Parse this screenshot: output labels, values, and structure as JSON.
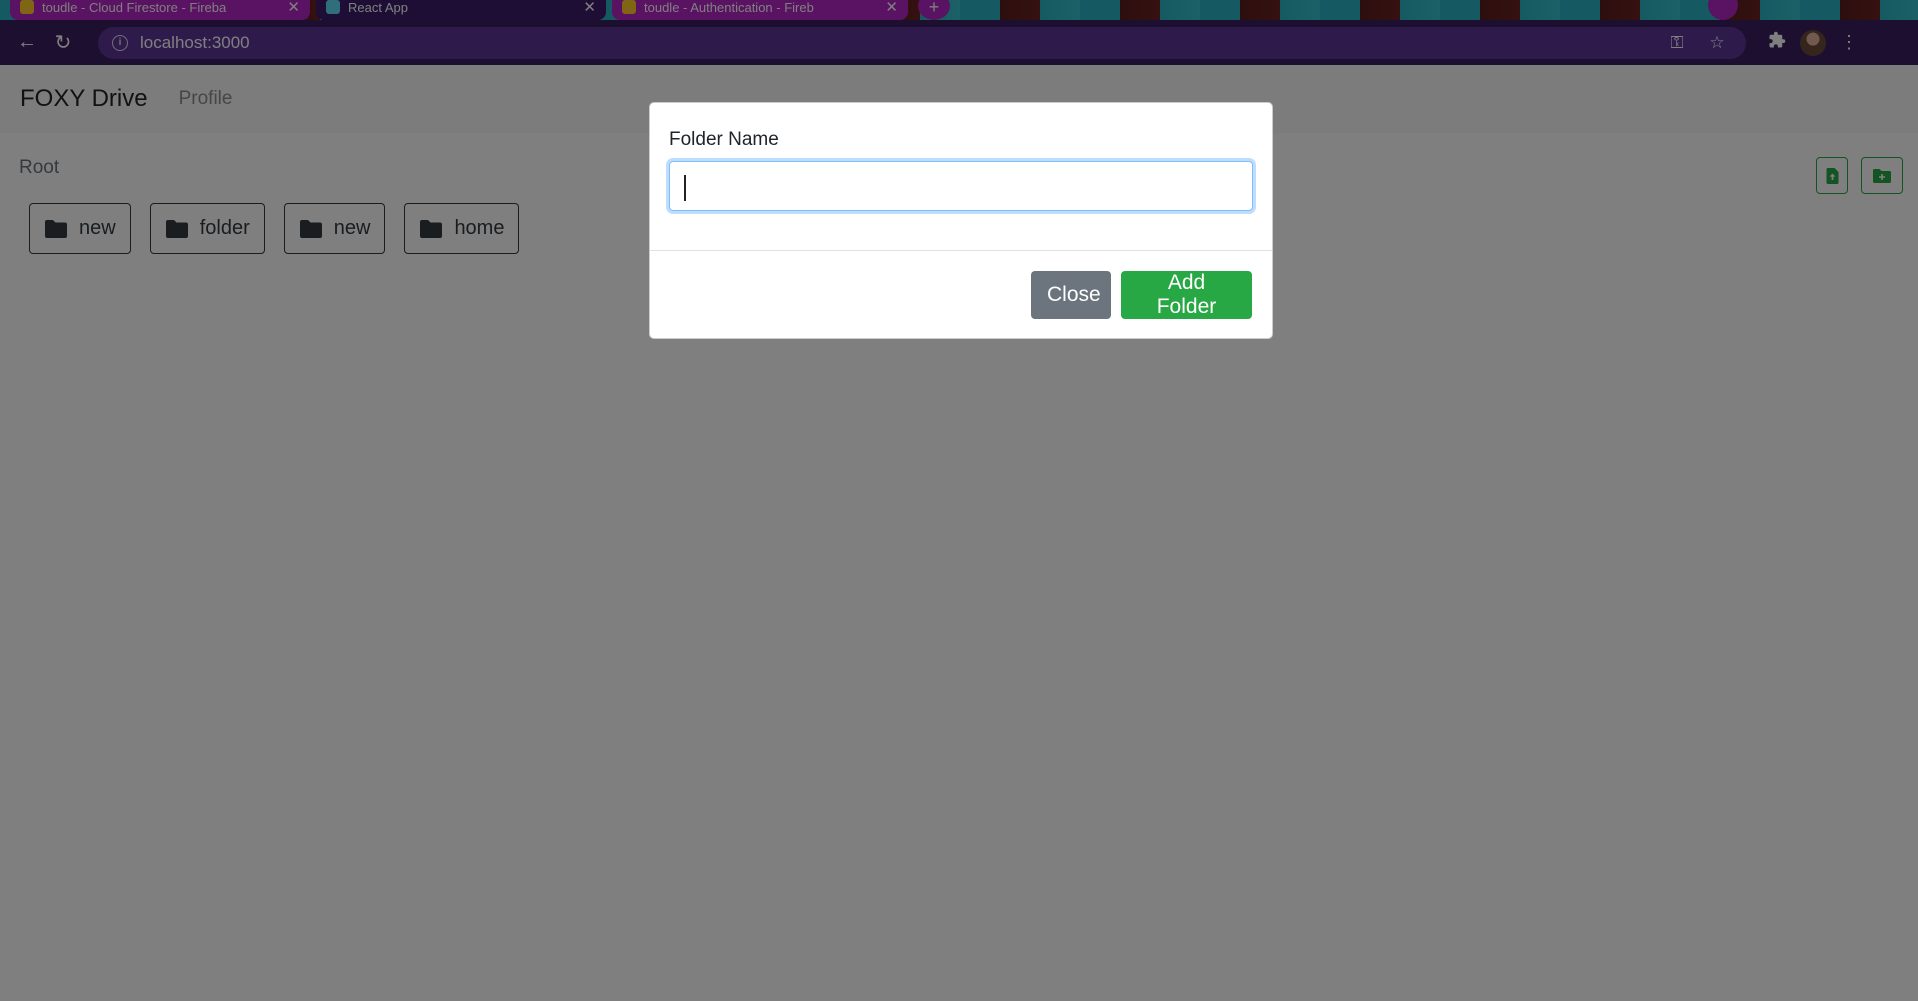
{
  "browser": {
    "tabs": [
      {
        "title": "toudle - Cloud Firestore - Fireba",
        "color": "#b326c4"
      },
      {
        "title": "React App",
        "color": "#3d1d6b"
      },
      {
        "title": "toudle - Authentication - Fireb",
        "color": "#b326c4"
      }
    ],
    "new_tab": "+",
    "url": "localhost:3000"
  },
  "app": {
    "brand": "FOXY Drive",
    "nav": {
      "profile": "Profile"
    },
    "breadcrumb": "Root",
    "folders": [
      "new",
      "folder",
      "new",
      "home"
    ],
    "accent_color": "#28a745"
  },
  "modal": {
    "label": "Folder Name",
    "input_value": "",
    "close_label": "Close",
    "add_label": "Add Folder"
  }
}
